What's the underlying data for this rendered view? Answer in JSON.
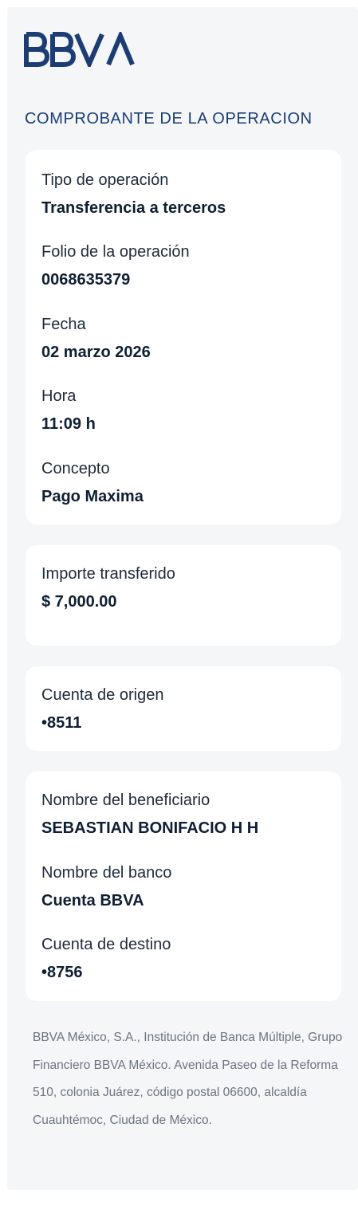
{
  "brand": {
    "logo_text": "BBVA",
    "logo_color": "#1b3d74"
  },
  "header": {
    "title": "COMPROBANTE DE LA OPERACION"
  },
  "operation": {
    "type_label": "Tipo de operación",
    "type_value": "Transferencia a terceros",
    "folio_label": "Folio de la operación",
    "folio_value": "0068635379",
    "date_label": "Fecha",
    "date_value": "02 marzo 2026",
    "time_label": "Hora",
    "time_value": "11:09 h",
    "concept_label": "Concepto",
    "concept_value": "Pago Maxima"
  },
  "amount": {
    "label": "Importe transferido",
    "value": "$ 7,000.00"
  },
  "origin": {
    "label": "Cuenta de origen",
    "value": "•8511"
  },
  "beneficiary": {
    "name_label": "Nombre del beneficiario",
    "name_value": "SEBASTIAN BONIFACIO H H",
    "bank_label": "Nombre del banco",
    "bank_value": "Cuenta BBVA",
    "account_label": "Cuenta de destino",
    "account_value": "•8756"
  },
  "footer": {
    "legal_text": "BBVA México, S.A., Institución de Banca Múltiple, Grupo Financiero BBVA México. Avenida Paseo de la Reforma 510, colonia Juárez, código postal 06600, alcaldía Cuauhtémoc, Ciudad de México."
  }
}
